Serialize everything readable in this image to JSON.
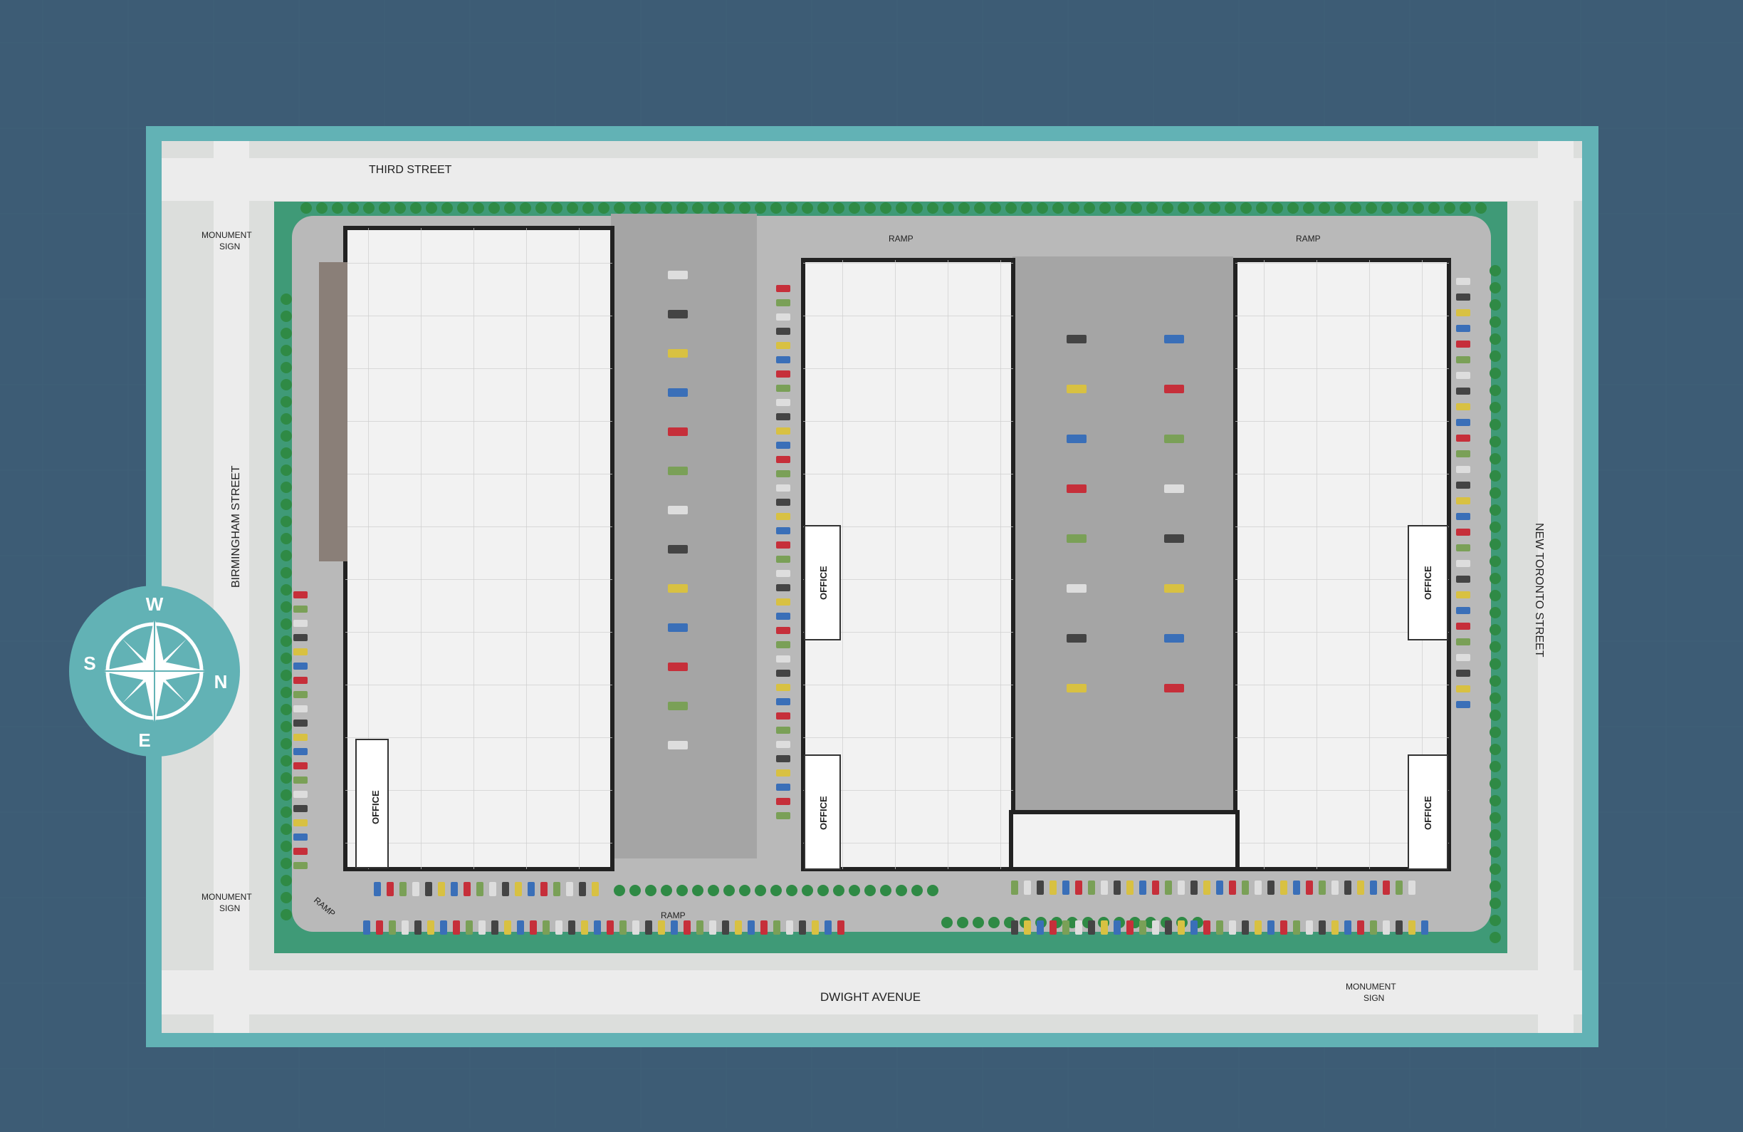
{
  "streets": {
    "north": "THIRD STREET",
    "west": "BIRMINGHAM STREET",
    "east": "NEW TORONTO STREET",
    "south": "DWIGHT AVENUE"
  },
  "labels": {
    "ramp": "RAMP",
    "office": "OFFICE",
    "monument_line1": "MONUMENT",
    "monument_line2": "SIGN"
  },
  "compass": {
    "top": "W",
    "left": "S",
    "right": "N",
    "bottom": "E"
  },
  "colors": {
    "background": "#3d5c75",
    "frame": "#62b2b5",
    "landscape": "#3f9a77",
    "tree": "#2f8a45",
    "building_floor": "#f2f2f2",
    "pavement": "#9e9e9e"
  }
}
